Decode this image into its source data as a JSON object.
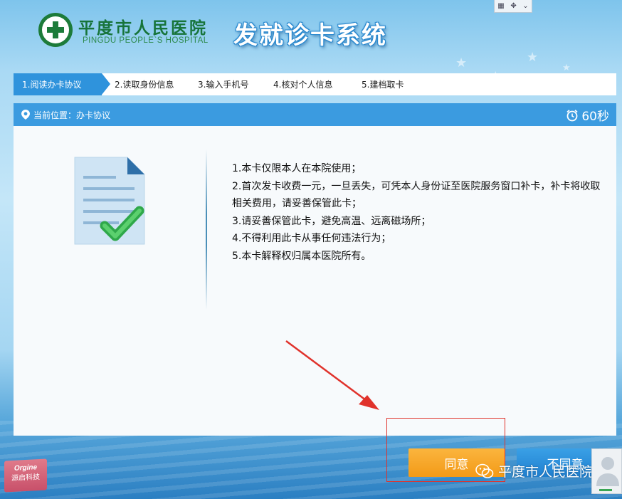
{
  "header": {
    "hospital_name_cn": "平度市人民医院",
    "hospital_name_en": "PINGDU PEOPLE`S HOSPITAL",
    "system_title": "发就诊卡系统"
  },
  "steps": [
    {
      "label": "1.阅读办卡协议",
      "active": true
    },
    {
      "label": "2.读取身份信息",
      "active": false
    },
    {
      "label": "3.输入手机号",
      "active": false
    },
    {
      "label": "4.核对个人信息",
      "active": false
    },
    {
      "label": "5.建档取卡",
      "active": false
    }
  ],
  "panel": {
    "location_text": "当前位置：办卡协议",
    "timer_text": "60秒"
  },
  "terms": [
    "1.本卡仅限本人在本院使用；",
    "2.首次发卡收费一元，一旦丢失，可凭本人身份证至医院服务窗口补卡，补卡将收取相关费用，请妥善保管此卡；",
    "3.请妥善保管此卡，避免高温、远离磁场所；",
    "4.不得利用此卡从事任何违法行为；",
    "5.本卡解释权归属本医院所有。"
  ],
  "buttons": {
    "agree_label": "同意",
    "disagree_label": "不同意"
  },
  "brand": {
    "en": "Orgine",
    "cn": "源启科技"
  },
  "watermark": {
    "text": "平度市人民医院"
  },
  "colors": {
    "primary_blue": "#2f93dc",
    "agree_orange": "#f5a623",
    "highlight_red": "#e0322b",
    "logo_green": "#1d7b3a"
  }
}
